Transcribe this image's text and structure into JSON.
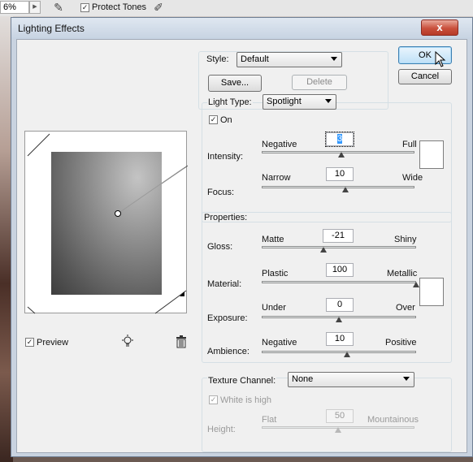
{
  "toolbar": {
    "zoom_value": "6%",
    "protect_tones_label": "Protect Tones",
    "protect_tones_checked": true
  },
  "dialog": {
    "title": "Lighting Effects",
    "close_glyph": "x"
  },
  "preview": {
    "checkbox_label": "Preview",
    "checked": true
  },
  "style": {
    "label": "Style:",
    "value": "Default",
    "save_label": "Save...",
    "delete_label": "Delete"
  },
  "buttons": {
    "ok_label": "OK",
    "cancel_label": "Cancel"
  },
  "light": {
    "type_label": "Light Type:",
    "type_value": "Spotlight",
    "on_label": "On",
    "on_checked": true,
    "intensity": {
      "label": "Intensity:",
      "min_label": "Negative",
      "max_label": "Full",
      "value": "3",
      "level": 0.52
    },
    "focus": {
      "label": "Focus:",
      "min_label": "Narrow",
      "max_label": "Wide",
      "value": "10",
      "level": 0.55
    }
  },
  "properties": {
    "label": "Properties:",
    "gloss": {
      "label": "Gloss:",
      "min_label": "Matte",
      "max_label": "Shiny",
      "value": "-21",
      "level": 0.4
    },
    "material": {
      "label": "Material:",
      "min_label": "Plastic",
      "max_label": "Metallic",
      "value": "100",
      "level": 1.0
    },
    "exposure": {
      "label": "Exposure:",
      "min_label": "Under",
      "max_label": "Over",
      "value": "0",
      "level": 0.5
    },
    "ambience": {
      "label": "Ambience:",
      "min_label": "Negative",
      "max_label": "Positive",
      "value": "10",
      "level": 0.55
    }
  },
  "texture": {
    "label": "Texture Channel:",
    "value": "None",
    "white_is_high_label": "White is high",
    "white_is_high_checked": true,
    "height": {
      "label": "Height:",
      "min_label": "Flat",
      "max_label": "Mountainous",
      "value": "50",
      "level": 0.5
    }
  }
}
